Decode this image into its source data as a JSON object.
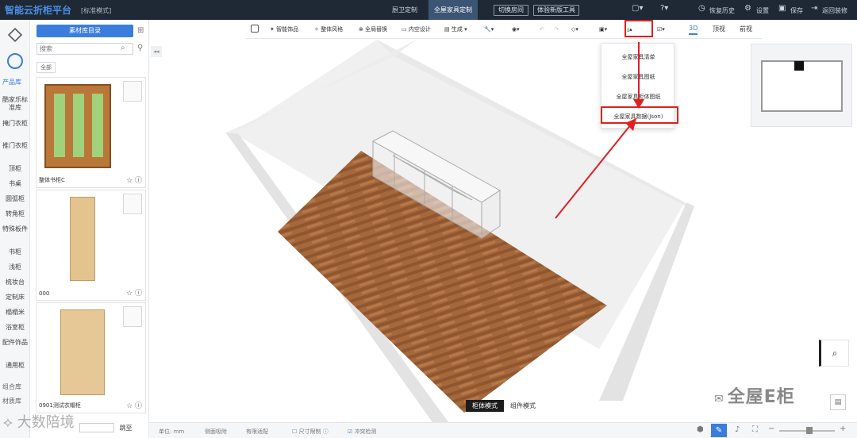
{
  "app": {
    "title": "智能云折柜平台",
    "mode": "[标准模式]"
  },
  "topbar": {
    "tab_kitchen": "厨卫定制",
    "tab_cabinet": "全屋家具定制",
    "switch_room": "切换房间",
    "new_tool": "体验新版工具",
    "restore_history": "恢复历史",
    "settings": "设置",
    "save": "保存",
    "back_decor": "返回装修"
  },
  "library": {
    "dir_button": "素材库目录",
    "search_placeholder": "搜索",
    "filter_all": "全部",
    "items": [
      {
        "name": "整体书柜C"
      },
      {
        "name": "000"
      },
      {
        "name": "0901测试衣帽柜"
      }
    ],
    "pager_goto": "跳至"
  },
  "rail": {
    "product_lib": "产品库",
    "categories": [
      "酷家乐标准库",
      "掩门衣柜",
      "推门衣柜",
      "顶柜",
      "书桌",
      "圆弧柜",
      "转角柜",
      "特殊板件",
      "书柜",
      "浅柜",
      "梳妆台",
      "定制床",
      "榻榻米",
      "浴室柜",
      "配件饰品",
      "通用柜"
    ],
    "combo_lib": "组合库",
    "material_lib": "材质库"
  },
  "toolbar": {
    "smart_decor": "智能饰品",
    "style": "整体风格",
    "whole_replace": "全局替换",
    "inner_design": "内空设计",
    "generate": "生成",
    "view_3d": "3D",
    "view_top": "顶视",
    "view_front": "前视"
  },
  "dropdown": {
    "items": [
      "全屋家具清单",
      "全屋家具图纸",
      "全屋家具柜体图纸",
      "全屋家具数据(Json)"
    ]
  },
  "statusbar": {
    "unit": "单位: mm",
    "side_snap": "侧面吸附",
    "adapt": "有限适配",
    "size_limit": "尺寸限制",
    "collision": "冲突检测",
    "mode_cabinet": "柜体模式",
    "mode_component": "组件模式"
  },
  "watermark": {
    "text": "全屋E柜",
    "wm_left": "大数陪境"
  },
  "colors": {
    "accent": "#3b7ddd",
    "annotation": "#e02020",
    "topbar": "#1f2835"
  }
}
